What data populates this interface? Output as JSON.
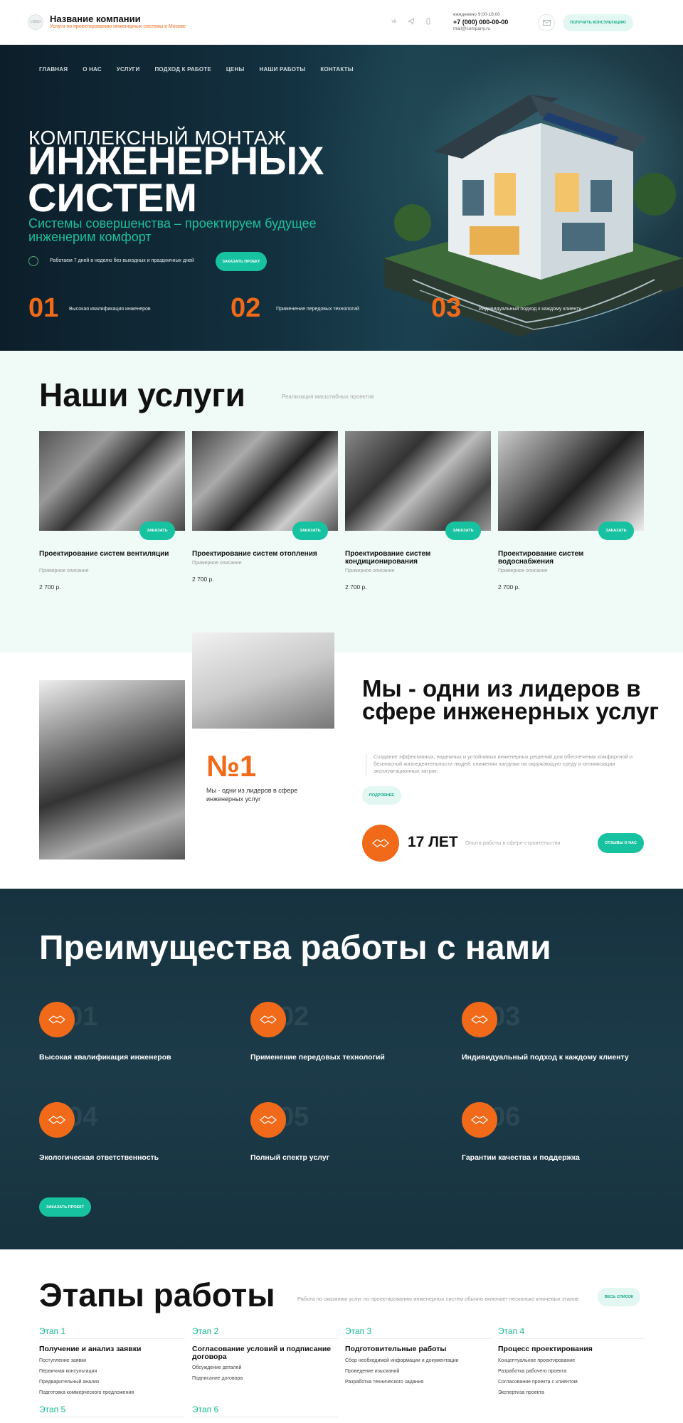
{
  "header": {
    "logo_text": "LOGO",
    "company_name": "Название компании",
    "company_sub": "Услуги по проектированию инженерных системы в Москве",
    "social": [
      "vk",
      "tg",
      "wa"
    ],
    "hours": "ежедневно 9:00-18:00",
    "phone": "+7 (000) 000-00-00",
    "email": "mail@company.ru",
    "consult_label": "ПОЛУЧИТЬ КОНСУЛЬТАЦИЮ"
  },
  "nav": [
    "ГЛАВНАЯ",
    "О НАС",
    "УСЛУГИ",
    "ПОДХОД К РАБОТЕ",
    "ЦЕНЫ",
    "НАШИ РАБОТЫ",
    "КОНТАКТЫ"
  ],
  "hero": {
    "line1": "КОМПЛЕКСНЫЙ МОНТАЖ",
    "line2": "ИНЖЕНЕРНЫХ СИСТЕМ",
    "tagline": "Системы совершенства – проектируем будущее инженерим комфорт",
    "work_text": "Работаем 7 дней в неделю без выходных и праздничных дней",
    "order_label": "ЗАКАЗАТЬ ПРОЕКТ",
    "features": [
      {
        "num": "01",
        "text": "Высокая квалификация инженеров"
      },
      {
        "num": "02",
        "text": "Применение передовых технологий"
      },
      {
        "num": "03",
        "text": "Индивидуальный подход к каждому клиенту"
      }
    ]
  },
  "services": {
    "title": "Наши услуги",
    "subtitle": "Реализация масштабных проектов",
    "order_label": "ЗАКАЗАТЬ",
    "cards": [
      {
        "title": "Проектирование систем вентиляции",
        "desc": "Примерное описание",
        "price": "2 700 р."
      },
      {
        "title": "Проектирование систем отопления",
        "desc": "Примерное описание",
        "price": "2 700 р."
      },
      {
        "title": "Проектирование систем кондиционирования",
        "desc": "Примерное описание",
        "price": "2 700 р."
      },
      {
        "title": "Проектирование систем водоснабжения",
        "desc": "Примерное описание",
        "price": "2 700 р."
      }
    ]
  },
  "leaders": {
    "title": "Мы - одни из лидеров в сфере инженерных услуг",
    "no1": "№1",
    "no1_text": "Мы - одни из лидеров в сфере инженерных услуг",
    "desc": "Создание эффективных, надежных и устойчивых инженерных решений для обеспечения комфортной и безопасной жизнедеятельности людей, снижения нагрузки на окружающую среду и оптимизации эксплуатационных затрат.",
    "more_label": "ПОДРОБНЕЕ",
    "years": "17 ЛЕТ",
    "years_text": "Опыта работы в сфере строительства",
    "reviews_label": "ОТЗЫВЫ О НАС"
  },
  "advantages": {
    "title": "Преимущества работы с нами",
    "items": [
      {
        "num": "01",
        "text": "Высокая квалификация инженеров"
      },
      {
        "num": "02",
        "text": "Применение передовых технологий"
      },
      {
        "num": "03",
        "text": "Индивидуальный подход к каждому клиенту"
      },
      {
        "num": "04",
        "text": "Экологическая ответственность"
      },
      {
        "num": "05",
        "text": "Полный спектр услуг"
      },
      {
        "num": "06",
        "text": "Гарантии качества и поддержка"
      }
    ],
    "order_label": "ЗАКАЗАТЬ ПРОЕКТ"
  },
  "stages": {
    "title": "Этапы работы",
    "subtitle": "Работа по оказанию услуг по проектированию инженерных систем обычно включает несколько ключевых этапов",
    "all_label": "ВЕСЬ СПИСОК",
    "items": [
      {
        "label": "Этап 1",
        "title": "Получение и анализ заявки",
        "steps": [
          "Поступление заявки",
          "Первичная консультация",
          "Предварительный анализ",
          "Подготовка коммерческого предложения"
        ]
      },
      {
        "label": "Этап 2",
        "title": "Согласование условий и подписание договора",
        "steps": [
          "Обсуждение деталей",
          "Подписание договора"
        ]
      },
      {
        "label": "Этап 3",
        "title": "Подготовительные работы",
        "steps": [
          "Сбор необходимой информации и документации",
          "Проведение изысканий",
          "Разработка технического задания"
        ]
      },
      {
        "label": "Этап 4",
        "title": "Процесс проектирования",
        "steps": [
          "Концептуальное проектирование",
          "Разработка рабочего проекта",
          "Согласование проекта с клиентом",
          "Экспертиза проекта"
        ]
      },
      {
        "label": "Этап 5",
        "title": "",
        "steps": []
      },
      {
        "label": "Этап 6",
        "title": "",
        "steps": []
      }
    ]
  }
}
